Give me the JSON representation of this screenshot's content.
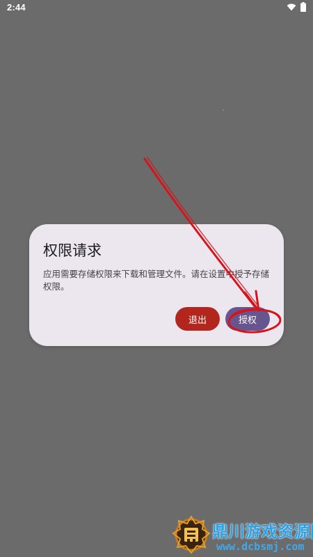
{
  "status_bar": {
    "time": "2:44",
    "wifi_icon": "wifi-icon",
    "battery_icon": "battery-icon"
  },
  "dialog": {
    "title": "权限请求",
    "message": "应用需要存储权限来下载和管理文件。请在设置中授予存储权限。",
    "exit_label": "退出",
    "grant_label": "授权",
    "exit_color": "#b3261e",
    "grant_color": "#67558f"
  },
  "annotation": {
    "color": "#d4151b",
    "arrow_icon": "arrow-icon",
    "highlight_icon": "ellipse-highlight-icon"
  },
  "watermark": {
    "title": "鼎川游戏资源网",
    "url": "www.dcbsmj.com"
  }
}
